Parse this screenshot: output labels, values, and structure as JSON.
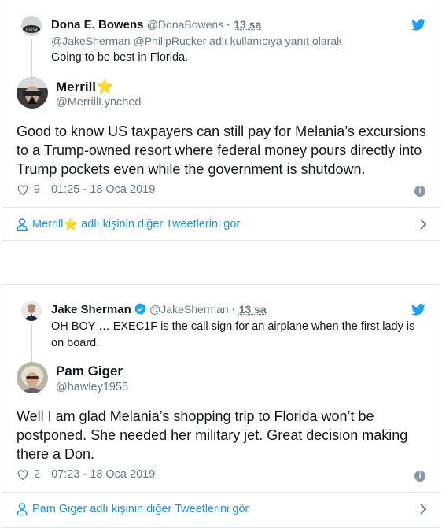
{
  "tweets": [
    {
      "parent": {
        "name": "Dona E. Bowens",
        "handle": "@DonaBowens",
        "sep": "·",
        "time": "13 sa",
        "reply_to": "@JakeSherman @PhilipRucker adlı kullanıcıya yanıt olarak",
        "text": "Going to be best in Florida.",
        "avatar_text": "dona"
      },
      "main": {
        "name": "Merrill",
        "name_emoji": "⭐",
        "handle": "@MerrillLynched",
        "text": "Good to know US taxpayers can still pay for Melania’s excursions to a Trump-owned resort where federal money pours directly into Trump pockets even while the government is shutdown.",
        "likes": "9",
        "timestamp": "01:25 - 18 Oca 2019"
      },
      "more_link": {
        "name": "Merrill",
        "emoji": "⭐",
        "suffix": " adlı kişinin diğer Tweetlerini gör"
      }
    },
    {
      "parent": {
        "name": "Jake Sherman",
        "handle": "@JakeSherman",
        "sep": "·",
        "time": "13 sa",
        "verified": true,
        "text": "OH BOY … EXEC1F is the call sign for an airplane when the first lady is on board."
      },
      "main": {
        "name": "Pam Giger",
        "handle": "@hawley1955",
        "text": "Well I am glad Melania’s shopping trip to Florida won’t be postponed. She needed her military jet. Great decision making there a Don.",
        "likes": "2",
        "timestamp": "07:23 - 18 Oca 2019"
      },
      "more_link": {
        "name": "Pam Giger",
        "suffix": " adlı kişinin diğer Tweetlerini gör"
      }
    }
  ],
  "colors": {
    "link": "#1b95e0",
    "muted": "#657786",
    "star": "#f5a623",
    "twitter_bird": "#1da1f2",
    "verified": "#1da1f2"
  }
}
